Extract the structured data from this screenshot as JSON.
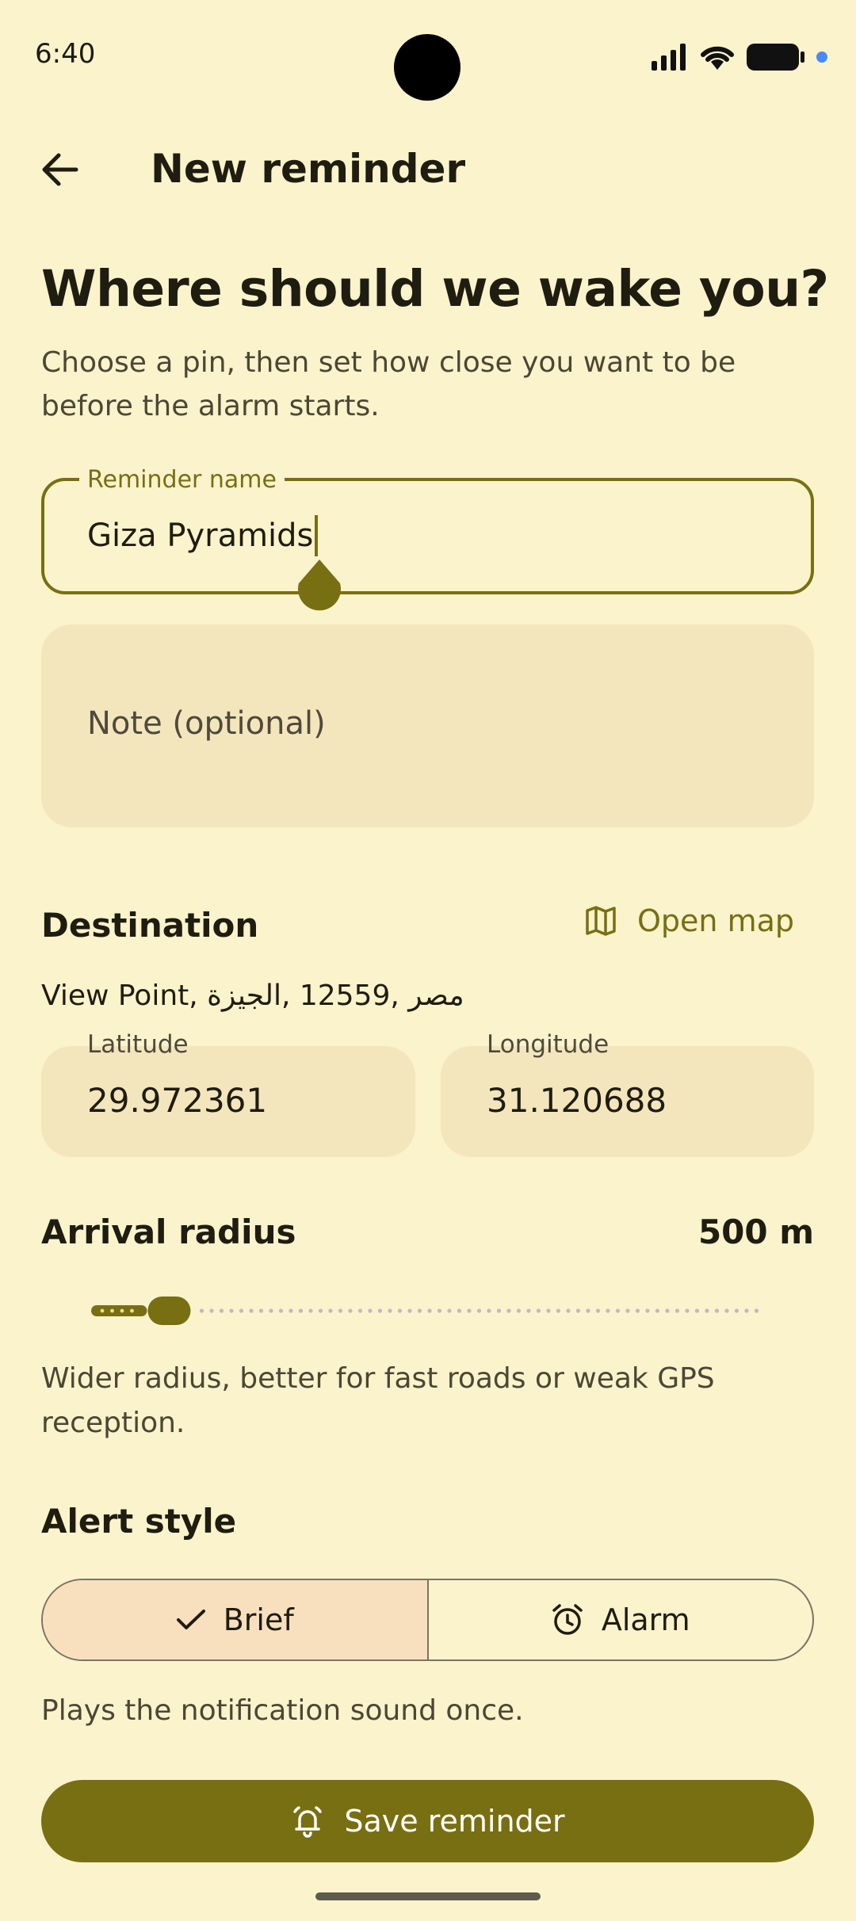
{
  "status_bar": {
    "time": "6:40"
  },
  "app_bar": {
    "title": "New reminder"
  },
  "headline": "Where should we wake you?",
  "subtitle": "Choose a pin, then set how close you want to be before the alarm starts.",
  "reminder_name": {
    "label": "Reminder name",
    "value": "Giza Pyramids"
  },
  "note": {
    "placeholder": "Note (optional)"
  },
  "destination": {
    "title": "Destination",
    "open_map_label": "Open map",
    "address": "View Point, مصر ,12559 ,الجيزة",
    "latitude": {
      "label": "Latitude",
      "value": "29.972361"
    },
    "longitude": {
      "label": "Longitude",
      "value": "31.120688"
    }
  },
  "arrival_radius": {
    "title": "Arrival radius",
    "value_label": "500 m",
    "slider_fraction": 0.09,
    "help": "Wider radius, better for fast roads or weak GPS reception."
  },
  "alert_style": {
    "title": "Alert style",
    "options": [
      {
        "label": "Brief",
        "icon": "check-icon",
        "selected": true
      },
      {
        "label": "Alarm",
        "icon": "alarm-clock-icon",
        "selected": false
      }
    ],
    "help": "Plays the notification sound once."
  },
  "save_button": {
    "label": "Save reminder",
    "icon": "bell-ring-icon"
  },
  "colors": {
    "background": "#fbf3cc",
    "accent": "#776f12",
    "surface": "#f3e6bd",
    "selected_segment": "#f8e0bf"
  }
}
